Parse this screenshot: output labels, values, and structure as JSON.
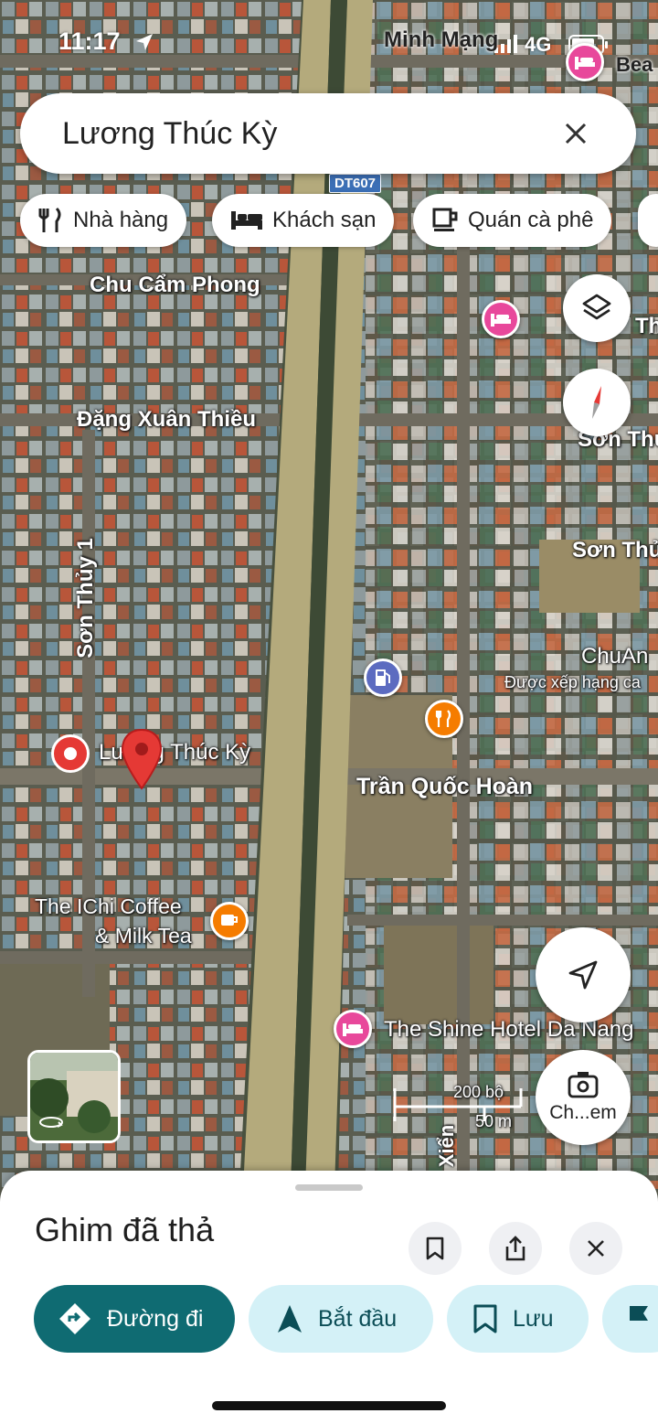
{
  "status_bar": {
    "time": "11:17",
    "network": "4G"
  },
  "search": {
    "query": "Lương Thúc Kỳ"
  },
  "chips": [
    {
      "label": "Nhà hàng",
      "icon": "fork-knife-icon"
    },
    {
      "label": "Khách sạn",
      "icon": "bed-icon"
    },
    {
      "label": "Quán cà phê",
      "icon": "coffee-cup-icon"
    }
  ],
  "map": {
    "labels": {
      "minh_mang": "Minh Mạng",
      "beach": "Bea",
      "dt607": "DT607",
      "chu_cam_phong": "Chu Cẩm Phong",
      "dang_xuan_thieu": "Đặng Xuân Thiều",
      "son_thuy_1": "Sơn Thủy 1",
      "son_thu_a": "Sơn Thu",
      "son_thu_b": "Sơn Thủ",
      "th": "Th",
      "chuan": "ChuAn",
      "duoc_xep_hang": "Được xếp hạng ca",
      "luong_thuc_ky": "Lương Thúc Kỳ",
      "tran_quoc_hoan": "Trần Quốc Hoàn",
      "ichi_coffee_1": "The IChi Coffee",
      "ichi_coffee_2": "& Milk Tea",
      "shine_hotel": "The Shine Hotel Da Nang",
      "xien": "Xiển",
      "scale_ft": "200 bộ",
      "scale_m": "50 m"
    },
    "camera_button_label": "Ch...em"
  },
  "sheet": {
    "title": "Ghim đã thả",
    "actions": [
      {
        "label": "Đường đi"
      },
      {
        "label": "Bắt đầu"
      },
      {
        "label": "Lưu"
      }
    ]
  },
  "colors": {
    "primary": "#0f6b72",
    "secondary": "#d4f1f7",
    "pin": "#e53935",
    "hotel": "#e8489b",
    "food": "#f57c00"
  }
}
